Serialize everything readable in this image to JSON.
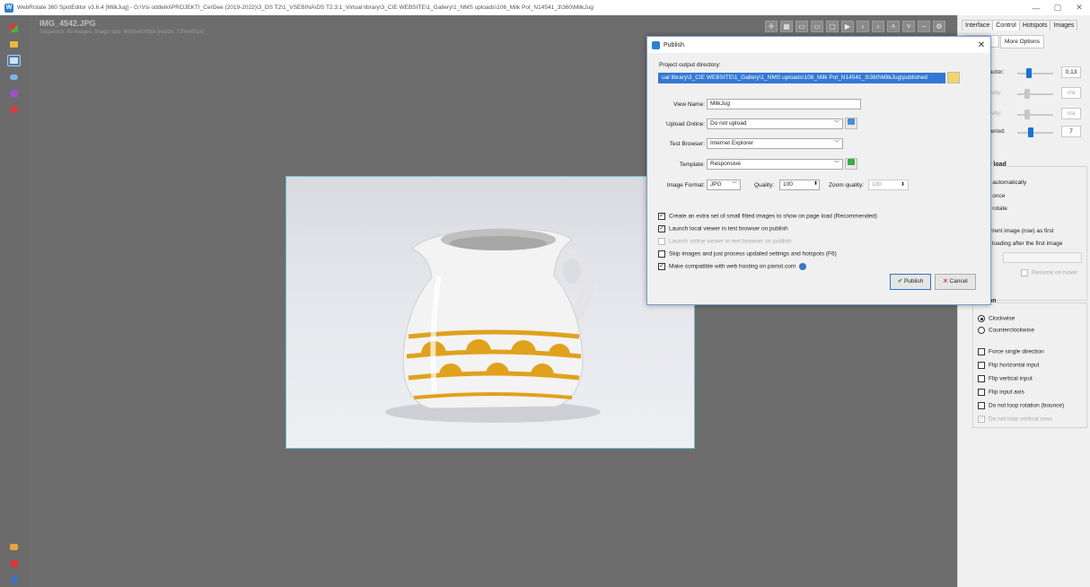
{
  "window": {
    "title": "WebRotate 360 SpotEditor v3.6.4 [MilkJug] - G:\\Vsi oddelki\\PROJEKTI_CerDee (2019-2022)\\3_DS T2\\1_VSEBINA\\DS T2.3.1_Virtual library\\3_CIE WEBSITE\\1_Gallery\\1_NMS uploads\\106_Milk Pot_N14541_3\\360\\MilkJug",
    "minimize": "—",
    "maximize": "▢",
    "close": "✕"
  },
  "canvas": {
    "image_name": "IMG_4542.JPG",
    "sequence_info": "Sequence: 48 images; Image size: 6000x4000px [resize: 720x480px]"
  },
  "right_panel": {
    "tabs": [
      "Interface",
      "Control",
      "Hotspots",
      "Images"
    ],
    "subtabs": [
      "",
      "More Options"
    ],
    "drag_factor": {
      "label": "rag factor:",
      "value": "0,13",
      "level": 0.25
    },
    "sensitivity1": {
      "label": "ensitivity:",
      "value": "n/a"
    },
    "sensitivity2": {
      "label": "ensitivity:",
      "value": "n/a"
    },
    "rotate_period": {
      "label": "ate period:",
      "value": "7",
      "level": 0.3
    },
    "view_load": {
      "title": "w load",
      "items": [
        "otate automatically",
        "otate once",
        "o not rotate",
        "et current image (row) as first",
        "ause loading after the first image"
      ],
      "field_label": "e:",
      "resume_label": "Resume on hover"
    },
    "rotation": {
      "title": "ion",
      "clockwise": "Clockwise",
      "counterclockwise": "Counterclockwise",
      "options": [
        "Force single direction",
        "Flip horizontal input",
        "Flip vertical input",
        "Flip input axis",
        "Do not loop rotation (bounce)",
        "Do not loop vertical rows"
      ]
    }
  },
  "dialog": {
    "title": "Publish",
    "output_label": "Project output directory:",
    "output_value": "ual library\\3_CIE WEBSITE\\1_Gallery\\1_NMS uploads\\106_Milk Pot_N14541_3\\360\\MilkJug\\published",
    "view_name_label": "View Name:",
    "view_name_value": "MilkJug",
    "upload_label": "Upload Online:",
    "upload_value": "Do not upload",
    "browser_label": "Test Browser:",
    "browser_value": "Internet Explorer",
    "template_label": "Template:",
    "template_value": "Responsive",
    "format_label": "Image Format:",
    "format_value": "JPG",
    "quality_label": "Quality:",
    "quality_value": "100",
    "zoom_label": "Zoom quality:",
    "zoom_value": "100",
    "checks": [
      {
        "label": "Create an extra set of small fitted images to show on page load (Recommended)",
        "checked": true,
        "enabled": true
      },
      {
        "label": "Launch local viewer in test browser on publish",
        "checked": true,
        "enabled": true
      },
      {
        "label": "Launch online viewer in test browser on publish",
        "checked": false,
        "enabled": false
      },
      {
        "label": "Skip images and just process updated settings and hotspots (F6)",
        "checked": false,
        "enabled": true
      },
      {
        "label": "Make compatible with web hosting on pixriot.com",
        "checked": true,
        "enabled": true
      }
    ],
    "publish_label": "Publish",
    "cancel_label": "Cancel"
  }
}
